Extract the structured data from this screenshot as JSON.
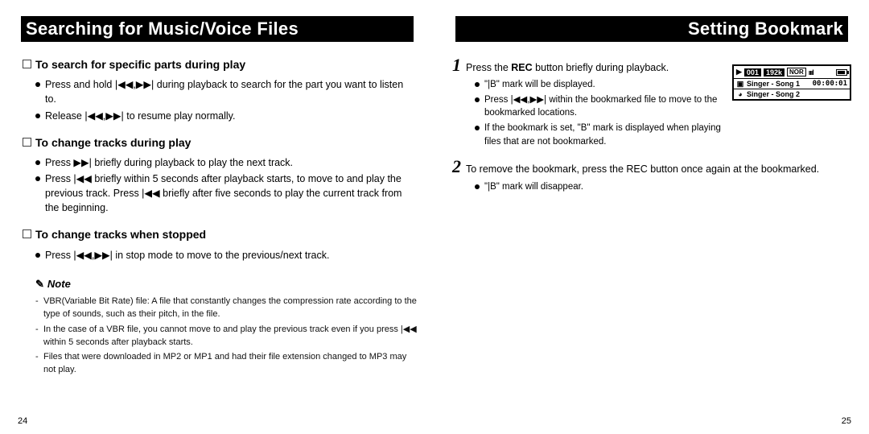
{
  "left": {
    "header": "Searching for Music/Voice Files",
    "sections": [
      {
        "head": "To search for specific parts during play",
        "bullets": [
          "Press and hold |◀◀,▶▶| during playback to search for the part you want to listen to.",
          "Release |◀◀,▶▶| to resume play normally."
        ]
      },
      {
        "head": "To change tracks during play",
        "bullets": [
          "Press ▶▶| briefly during playback to play the next track.",
          "Press |◀◀ briefly within 5 seconds after playback starts, to move to and play the previous track. Press |◀◀ briefly after five seconds to play the current track from the beginning."
        ]
      },
      {
        "head": "To change tracks when stopped",
        "bullets": [
          "Press |◀◀,▶▶| in stop mode to move to the previous/next track."
        ]
      }
    ],
    "note_label": "Note",
    "notes": [
      "VBR(Variable Bit Rate) file: A file that constantly changes the compression rate according to the type of sounds, such as their pitch, in the file.",
      "In the case of a VBR file, you cannot move to and play the previous track even if you press |◀◀ within 5 seconds after playback starts.",
      "Files that were downloaded in MP2 or MP1 and had their file extension changed to MP3 may not play."
    ],
    "page_num": "24"
  },
  "right": {
    "header": "Setting Bookmark",
    "steps": [
      {
        "num": "1",
        "text_parts": [
          "Press the ",
          "REC",
          " button briefly during playback."
        ],
        "subs": [
          "\"|B\" mark will be displayed.",
          "Press |◀◀,▶▶| within the bookmarked file to move to the bookmarked locations.",
          "If the bookmark is set, \"B\" mark is displayed when playing files that are not bookmarked."
        ]
      },
      {
        "num": "2",
        "text_parts": [
          "To remove the bookmark, press the REC button once again at the bookmarked."
        ],
        "subs": [
          "\"|B\" mark will disappear."
        ]
      }
    ],
    "lcd": {
      "track": "001",
      "rate": "192k",
      "nor": "NOR",
      "song1": "Singer - Song 1",
      "time": "00:00:01",
      "song2": "Singer - Song 2"
    },
    "page_num": "25"
  }
}
